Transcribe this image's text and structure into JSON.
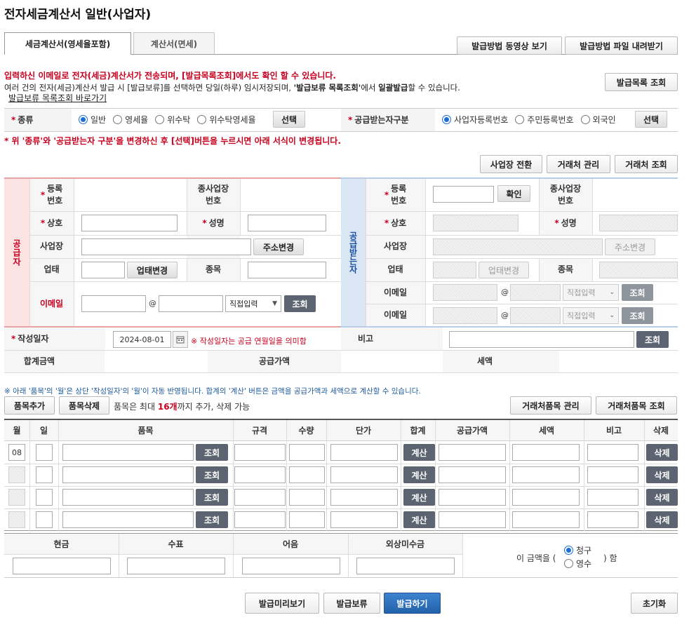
{
  "page": {
    "title": "전자세금계산서 일반(사업자)"
  },
  "tabs": [
    {
      "label": "세금계산서(영세율포함)",
      "active": true
    },
    {
      "label": "계산서(면세)",
      "active": false
    }
  ],
  "top_buttons": {
    "video": "발급방법 동영상 보기",
    "download": "발급방법 파일 내려받기"
  },
  "notice": {
    "line1": "입력하신 이메일로 전자(세금)계산서가 전송되며, [발급목록조회]에서도 확인 할 수 있습니다.",
    "line2_a": "여러 건의 전자(세금)계산서 발급 시 [발급보류]를 선택하면 당일(하루) 임시저장되며, ",
    "line2_b": "'발급보류 목록조회'",
    "line2_c": "에서 ",
    "line2_d": "일괄발급",
    "line2_e": "할 수 있습니다.",
    "link": "발급보류 목록조회 바로가기",
    "list_button": "발급목록 조회"
  },
  "type_row": {
    "label": "종류",
    "options": [
      "일반",
      "영세율",
      "위수탁",
      "위수탁영세율"
    ],
    "selected": "일반",
    "select_button": "선택",
    "receiver_label": "공급받는자구분",
    "receiver_options": [
      "사업자등록번호",
      "주민등록번호",
      "외국인"
    ],
    "receiver_selected": "사업자등록번호",
    "receiver_button": "선택"
  },
  "warning": "* 위 '종류'와 '공급받는자 구분'을 변경하신 후 [선택]버튼을 누르시면 아래 서식이 변경됩니다.",
  "biz_buttons": {
    "switch": "사업장 전환",
    "partner_manage": "거래처 관리",
    "partner_search": "거래처 조회"
  },
  "supplier": {
    "side_label": "공급자",
    "reg_no_label": "등록\n번호",
    "sub_biz_label": "종사업장\n번호",
    "company_label": "상호",
    "name_label": "성명",
    "address_label": "사업장",
    "address_button": "주소변경",
    "biz_type_label": "업태",
    "biz_type_button": "업태변경",
    "biz_item_label": "종목",
    "email_label": "이메일",
    "email_select": "직접입력",
    "email_button": "조회"
  },
  "receiver": {
    "side_label": "공급받는자",
    "reg_no_label": "등록\n번호",
    "confirm_button": "확인",
    "sub_biz_label": "종사업장\n번호",
    "company_label": "상호",
    "name_label": "성명",
    "address_label": "사업장",
    "address_button": "주소변경",
    "biz_type_label": "업태",
    "biz_type_button": "업태변경",
    "biz_item_label": "종목",
    "email_label": "이메일",
    "email_select": "직접입력",
    "email_button": "조회"
  },
  "date_row": {
    "label": "작성일자",
    "value": "2024-08-01",
    "note": "※ 작성일자는 공급 연월일을 의미함",
    "remark_label": "비고",
    "remark_button": "조회"
  },
  "totals": {
    "total_label": "합계금액",
    "supply_label": "공급가액",
    "tax_label": "세액"
  },
  "items_notice": "※ 아래 '품목'의 '월'은 상단 '작성일자'의 '월'이 자동 반영됩니다. 합계의 '계산' 버튼은 금액을 공급가액과 세액으로 계산할 수 있습니다.",
  "items_toolbar": {
    "add": "품목추가",
    "delete": "품목삭제",
    "limit_a": "품목은 최대 ",
    "limit_b": "16개",
    "limit_c": "까지 추가, 삭제 가능",
    "partner_item_manage": "거래처품목 관리",
    "partner_item_search": "거래처품목 조회"
  },
  "items_table": {
    "headers": [
      "월",
      "일",
      "품목",
      "규격",
      "수량",
      "단가",
      "합계",
      "공급가액",
      "세액",
      "비고",
      "삭제"
    ],
    "rows": [
      {
        "month": "08"
      },
      {
        "month": ""
      },
      {
        "month": ""
      },
      {
        "month": ""
      }
    ],
    "search_button": "조회",
    "calc_button": "계산",
    "delete_button": "삭제"
  },
  "payment": {
    "headers": [
      "현금",
      "수표",
      "어음",
      "외상미수금"
    ],
    "amount_prefix": "이 금액을 (",
    "options": [
      "청구",
      "영수"
    ],
    "selected": "청구",
    "suffix": ") 함"
  },
  "bottom_buttons": {
    "preview": "발급미리보기",
    "hold": "발급보류",
    "issue": "발급하기",
    "reset": "초기화"
  },
  "colors": {
    "supplier": "#e8a3a3",
    "receiver": "#b9cdea",
    "red": "#c7001e",
    "issue_button": "#2a6db8"
  }
}
